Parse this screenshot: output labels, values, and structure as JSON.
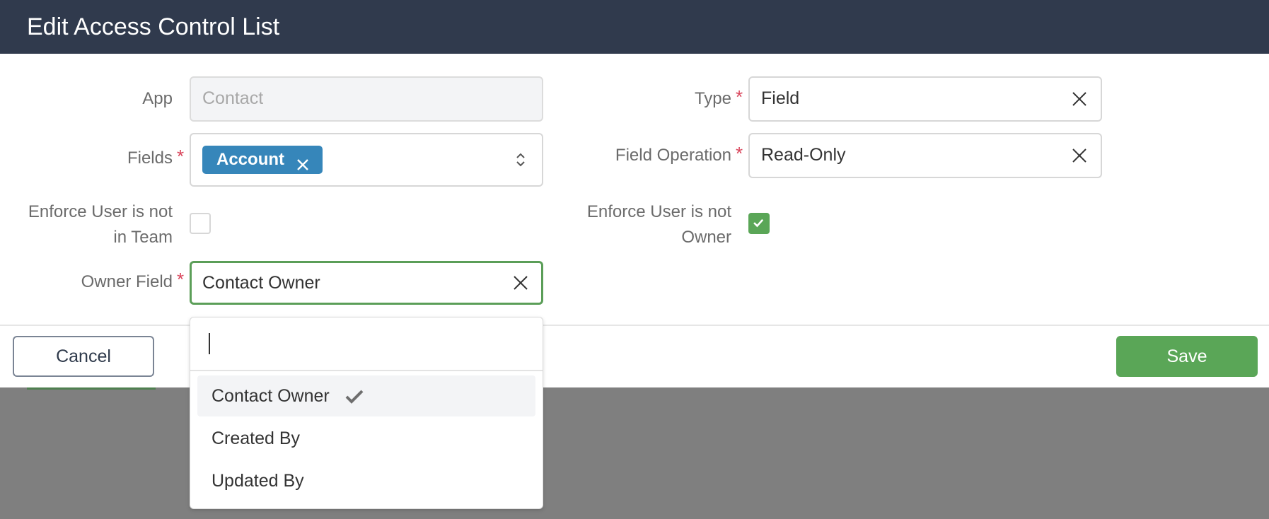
{
  "dialog": {
    "title": "Edit Access Control List",
    "cancel_label": "Cancel",
    "save_label": "Save"
  },
  "form": {
    "app": {
      "label": "App",
      "value": "Contact"
    },
    "fields": {
      "label": "Fields",
      "tags": [
        "Account"
      ]
    },
    "enforce_team": {
      "label_line1": "Enforce User is not",
      "label_line2": "in Team",
      "checked": false
    },
    "owner_field": {
      "label": "Owner Field",
      "value": "Contact Owner"
    },
    "type": {
      "label": "Type",
      "value": "Field"
    },
    "field_operation": {
      "label": "Field Operation",
      "value": "Read-Only"
    },
    "enforce_owner": {
      "label_line1": "Enforce User is not",
      "label_line2": "Owner",
      "checked": true
    },
    "required_mark": "*"
  },
  "owner_dropdown": {
    "search_value": "",
    "options": [
      {
        "label": "Contact Owner",
        "selected": true
      },
      {
        "label": "Created By",
        "selected": false
      },
      {
        "label": "Updated By",
        "selected": false
      }
    ]
  },
  "colors": {
    "header_bg": "#303a4d",
    "accent_green": "#5aa657",
    "tag_blue": "#3686ba",
    "required_red": "#d9455b",
    "overlay": "#7f7f7f"
  },
  "icons": {
    "clear": "close-icon",
    "select": "chevron-up-down-icon",
    "checked": "checkmark-icon"
  }
}
